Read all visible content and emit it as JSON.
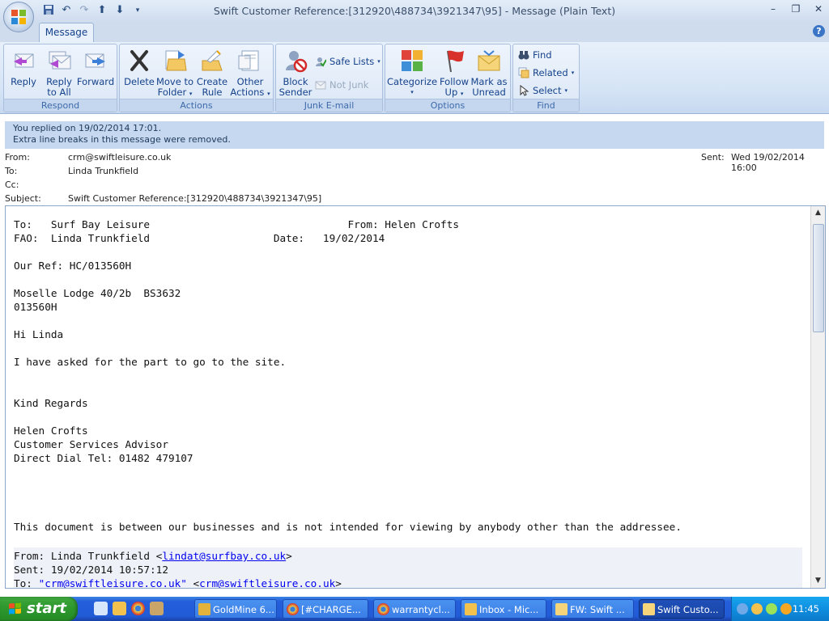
{
  "window": {
    "title": "Swift Customer Reference:[312920\\488734\\3921347\\95] - Message (Plain Text)"
  },
  "ribbon": {
    "tab": "Message",
    "groups": {
      "respond": {
        "label": "Respond",
        "reply": "Reply",
        "reply_all_1": "Reply",
        "reply_all_2": "to All",
        "forward": "Forward"
      },
      "actions": {
        "label": "Actions",
        "delete": "Delete",
        "move_1": "Move to",
        "move_2": "Folder",
        "create_1": "Create",
        "create_2": "Rule",
        "other_1": "Other",
        "other_2": "Actions"
      },
      "junk": {
        "label": "Junk E-mail",
        "block_1": "Block",
        "block_2": "Sender",
        "safe_lists": "Safe Lists",
        "not_junk": "Not Junk"
      },
      "options": {
        "label": "Options",
        "categorize": "Categorize",
        "follow_1": "Follow",
        "follow_2": "Up",
        "mark_1": "Mark as",
        "mark_2": "Unread"
      },
      "find": {
        "label": "Find",
        "find": "Find",
        "related": "Related",
        "select": "Select"
      }
    }
  },
  "infobar": {
    "line1": "You replied on 19/02/2014 17:01.",
    "line2": "Extra line breaks in this message were removed."
  },
  "header": {
    "from_label": "From:",
    "from_value": "crm@swiftleisure.co.uk",
    "to_label": "To:",
    "to_value": "Linda Trunkfield",
    "cc_label": "Cc:",
    "cc_value": "",
    "subject_label": "Subject:",
    "subject_value": "Swift Customer Reference:[312920\\488734\\3921347\\95]",
    "sent_label": "Sent:",
    "sent_value": "Wed 19/02/2014 16:00"
  },
  "body": {
    "text": "To:   Surf Bay Leisure                                From: Helen Crofts\nFAO:  Linda Trunkfield                    Date:   19/02/2014\n\nOur Ref: HC/013560H\n\nMoselle Lodge 40/2b  BS3632\n013560H\n\nHi Linda\n\nI have asked for the part to go to the site.\n\n\nKind Regards\n\nHelen Crofts\nCustomer Services Advisor\nDirect Dial Tel: 01482 479107\n\n\n\n\nThis document is between our businesses and is not intended for viewing by anybody other than the addressee.",
    "quote": {
      "from_prefix": "From: Linda Trunkfield <",
      "from_email": "lindat@surfbay.co.uk",
      "from_suffix": ">",
      "sent": "Sent: 19/02/2014 10:57:12",
      "to_prefix": "To: ",
      "to_link1": "\"crm@swiftleisure.co.uk\"",
      "to_mid": " <",
      "to_link2": "crm@swiftleisure.co.uk",
      "to_suffix": ">"
    }
  },
  "taskbar": {
    "start": "start",
    "items": [
      "GoldMine 6...",
      "[#CHARGE...",
      "warrantycl...",
      "Inbox - Mic...",
      "FW: Swift ...",
      "Swift Custo..."
    ],
    "clock": "11:45"
  },
  "colors": {
    "ribbon_blue": "#15428b",
    "infobar": "#c6d8ef",
    "taskbar": "#245edb",
    "start_green": "#2f9a2f"
  }
}
